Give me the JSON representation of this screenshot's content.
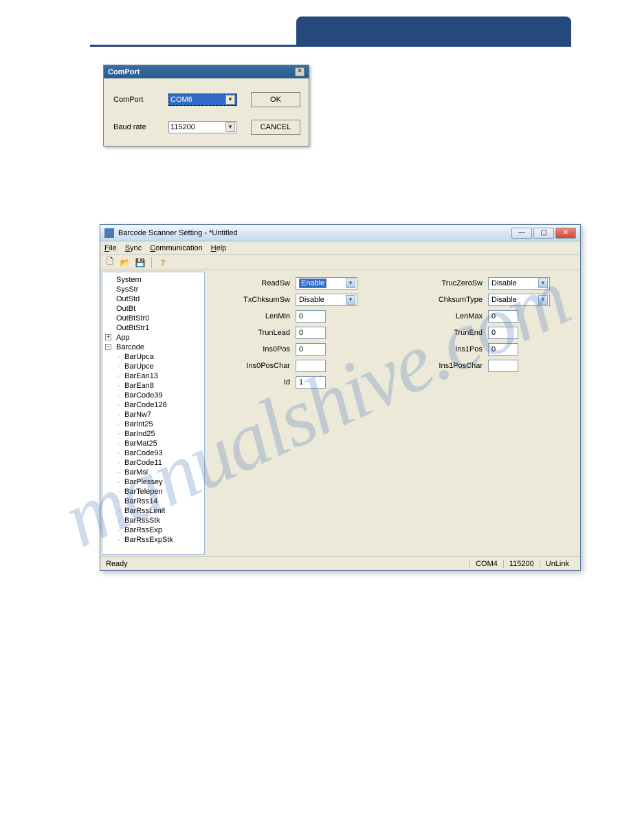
{
  "comport_dialog": {
    "title": "ComPort",
    "labels": {
      "comport": "ComPort",
      "baudrate": "Baud rate"
    },
    "values": {
      "comport": "COM6",
      "baudrate": "115200"
    },
    "buttons": {
      "ok": "OK",
      "cancel": "CANCEL"
    }
  },
  "app": {
    "title": "Barcode Scanner Setting - *Untitled",
    "menu": {
      "file": "File",
      "sync": "Sync",
      "communication": "Communication",
      "help": "Help"
    },
    "tree": {
      "roots": [
        "System",
        "SysStr",
        "OutStd",
        "OutBt",
        "OutBtStr0",
        "OutBtStr1",
        "App",
        "Barcode"
      ],
      "barcode_children": [
        "BarUpca",
        "BarUpce",
        "BarEan13",
        "BarEan8",
        "BarCode39",
        "BarCode128",
        "BarNw7",
        "BarInt25",
        "BarInd25",
        "BarMat25",
        "BarCode93",
        "BarCode11",
        "BarMsi",
        "BarPlessey",
        "BarTelepen",
        "BarRss14",
        "BarRssLimit",
        "BarRssStk",
        "BarRssExp",
        "BarRssExpStk"
      ]
    },
    "form": {
      "labels": {
        "readsw": "ReadSw",
        "truczero": "TrucZeroSw",
        "txchksum": "TxChksumSw",
        "chksumtype": "ChksumType",
        "lenmin": "LenMin",
        "lenmax": "LenMax",
        "trunlead": "TrunLead",
        "trunend": "TrunEnd",
        "ins0pos": "Ins0Pos",
        "ins1pos": "Ins1Pos",
        "ins0posch": "Ins0PosChar",
        "ins1posch": "Ins1PosChar",
        "id": "Id"
      },
      "values": {
        "readsw": "Enable",
        "truczero": "Disable",
        "txchksum": "Disable",
        "chksumtype": "Disable",
        "lenmin": "0",
        "lenmax": "0",
        "trunlead": "0",
        "trunend": "0",
        "ins0pos": "0",
        "ins1pos": "0",
        "ins0posch": "",
        "ins1posch": "",
        "id": "1"
      }
    },
    "status": {
      "ready": "Ready",
      "com": "COM4",
      "baud": "115200",
      "link": "UnLink"
    }
  },
  "watermark": "manualshive.com"
}
